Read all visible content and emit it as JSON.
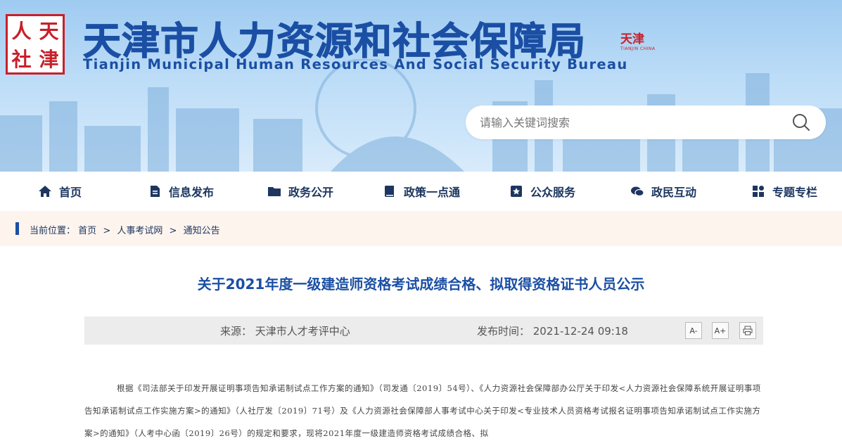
{
  "header": {
    "logo_chars": [
      "人",
      "天",
      "社",
      "津"
    ],
    "title_cn": "天津市人力资源和社会保障局",
    "title_en": "Tianjin Municipal Human Resources And Social Security Bureau",
    "stamp_text": "天津",
    "stamp_sub": "TIANJIN CHINA"
  },
  "search": {
    "placeholder": "请输入关键词搜索"
  },
  "nav": {
    "items": [
      {
        "label": "首页",
        "icon": "home-icon"
      },
      {
        "label": "信息发布",
        "icon": "document-icon"
      },
      {
        "label": "政务公开",
        "icon": "folder-icon"
      },
      {
        "label": "政策一点通",
        "icon": "book-icon"
      },
      {
        "label": "公众服务",
        "icon": "star-badge-icon"
      },
      {
        "label": "政民互动",
        "icon": "chat-icon"
      },
      {
        "label": "专题专栏",
        "icon": "grid-icon"
      }
    ]
  },
  "breadcrumb": {
    "prefix": "当前位置：",
    "items": [
      "首页",
      "人事考试网",
      "通知公告"
    ],
    "separator": ">"
  },
  "article": {
    "title": "关于2021年度一级建造师资格考试成绩合格、拟取得资格证书人员公示",
    "source": "来源：  天津市人才考评中心",
    "publish_time": "发布时间：  2021-12-24 09:18",
    "tools": [
      "A-",
      "A+",
      "print"
    ],
    "body": "根据《司法部关于印发开展证明事项告知承诺制试点工作方案的通知》（司发通〔2019〕54号）、《人力资源社会保障部办公厅关于印发<人力资源社会保障系统开展证明事项告知承诺制试点工作实施方案>的通知》（人社厅发〔2019〕71号）及《人力资源社会保障部人事考试中心关于印发<专业技术人员资格考试报名证明事项告知承诺制试点工作实施方案>的通知》（人考中心函〔2019〕26号）的规定和要求，现将2021年度一级建造师资格考试成绩合格、拟"
  },
  "colors": {
    "brand_blue": "#1b4fa4",
    "nav_text": "#1d3660",
    "seal_red": "#c8202a",
    "page_bg": "#fdf4ee"
  }
}
